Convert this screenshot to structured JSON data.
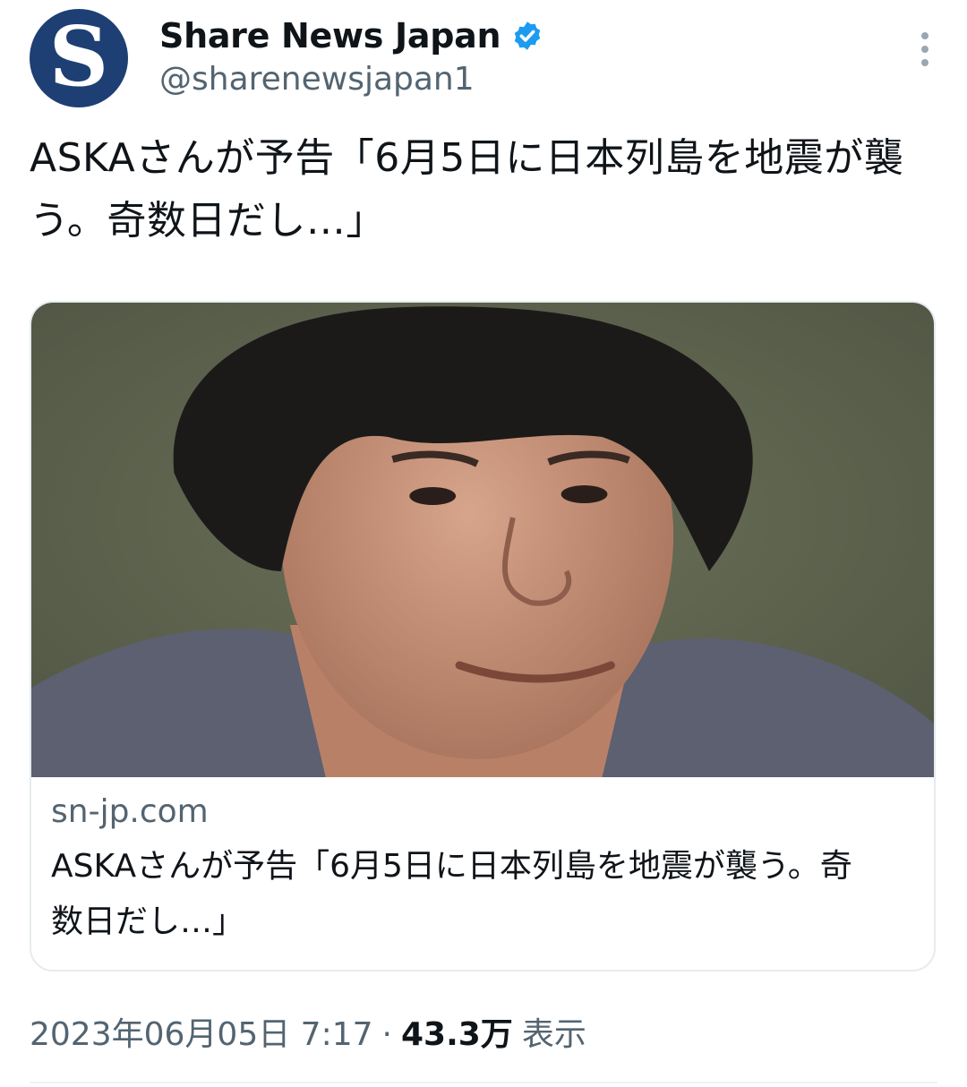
{
  "author": {
    "avatar_letter": "S",
    "name": "Share News Japan",
    "handle": "@sharenewsjapan1",
    "verified": true
  },
  "tweet": {
    "text": "ASKAさんが予告「6月5日に日本列島を地震が襲う。奇数日だし…」"
  },
  "card": {
    "domain": "sn-jp.com",
    "title": "ASKAさんが予告「6月5日に日本列島を地震が襲う。奇数日だし…」"
  },
  "meta": {
    "timestamp": "2023年06月05日 7:17",
    "separator": "·",
    "views": "43.3万",
    "views_label": "表示"
  },
  "colors": {
    "avatar_bg": "#1d3f73",
    "verified_blue": "#1d9bf0",
    "muted_text": "#536471"
  },
  "icons": {
    "verified": "verified-badge-icon",
    "more": "more-options-icon"
  }
}
